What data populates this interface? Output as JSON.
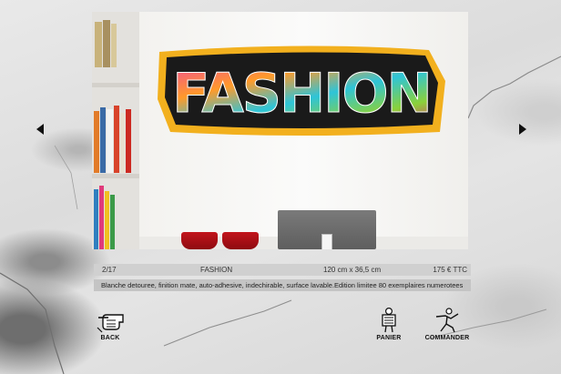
{
  "product": {
    "index": "2/17",
    "name": "FASHION",
    "dimensions": "120 cm x 36,5 cm",
    "price": "175 € TTC",
    "description": "Blanche detouree, finition mate, auto-adhesive, indechirable, surface lavable.Edition limitee 80 exemplaires numerotees",
    "graffiti_text": "FASHION"
  },
  "navigation": {
    "prev_icon": "triangle-left-icon",
    "next_icon": "triangle-right-icon"
  },
  "actions": {
    "back_label": "BACK",
    "cart_label": "PANIER",
    "order_label": "COMMANDER"
  },
  "colors": {
    "info_bar": "#d0d0d0",
    "description_bar": "#c4c4c4",
    "arrow": "#111111"
  }
}
